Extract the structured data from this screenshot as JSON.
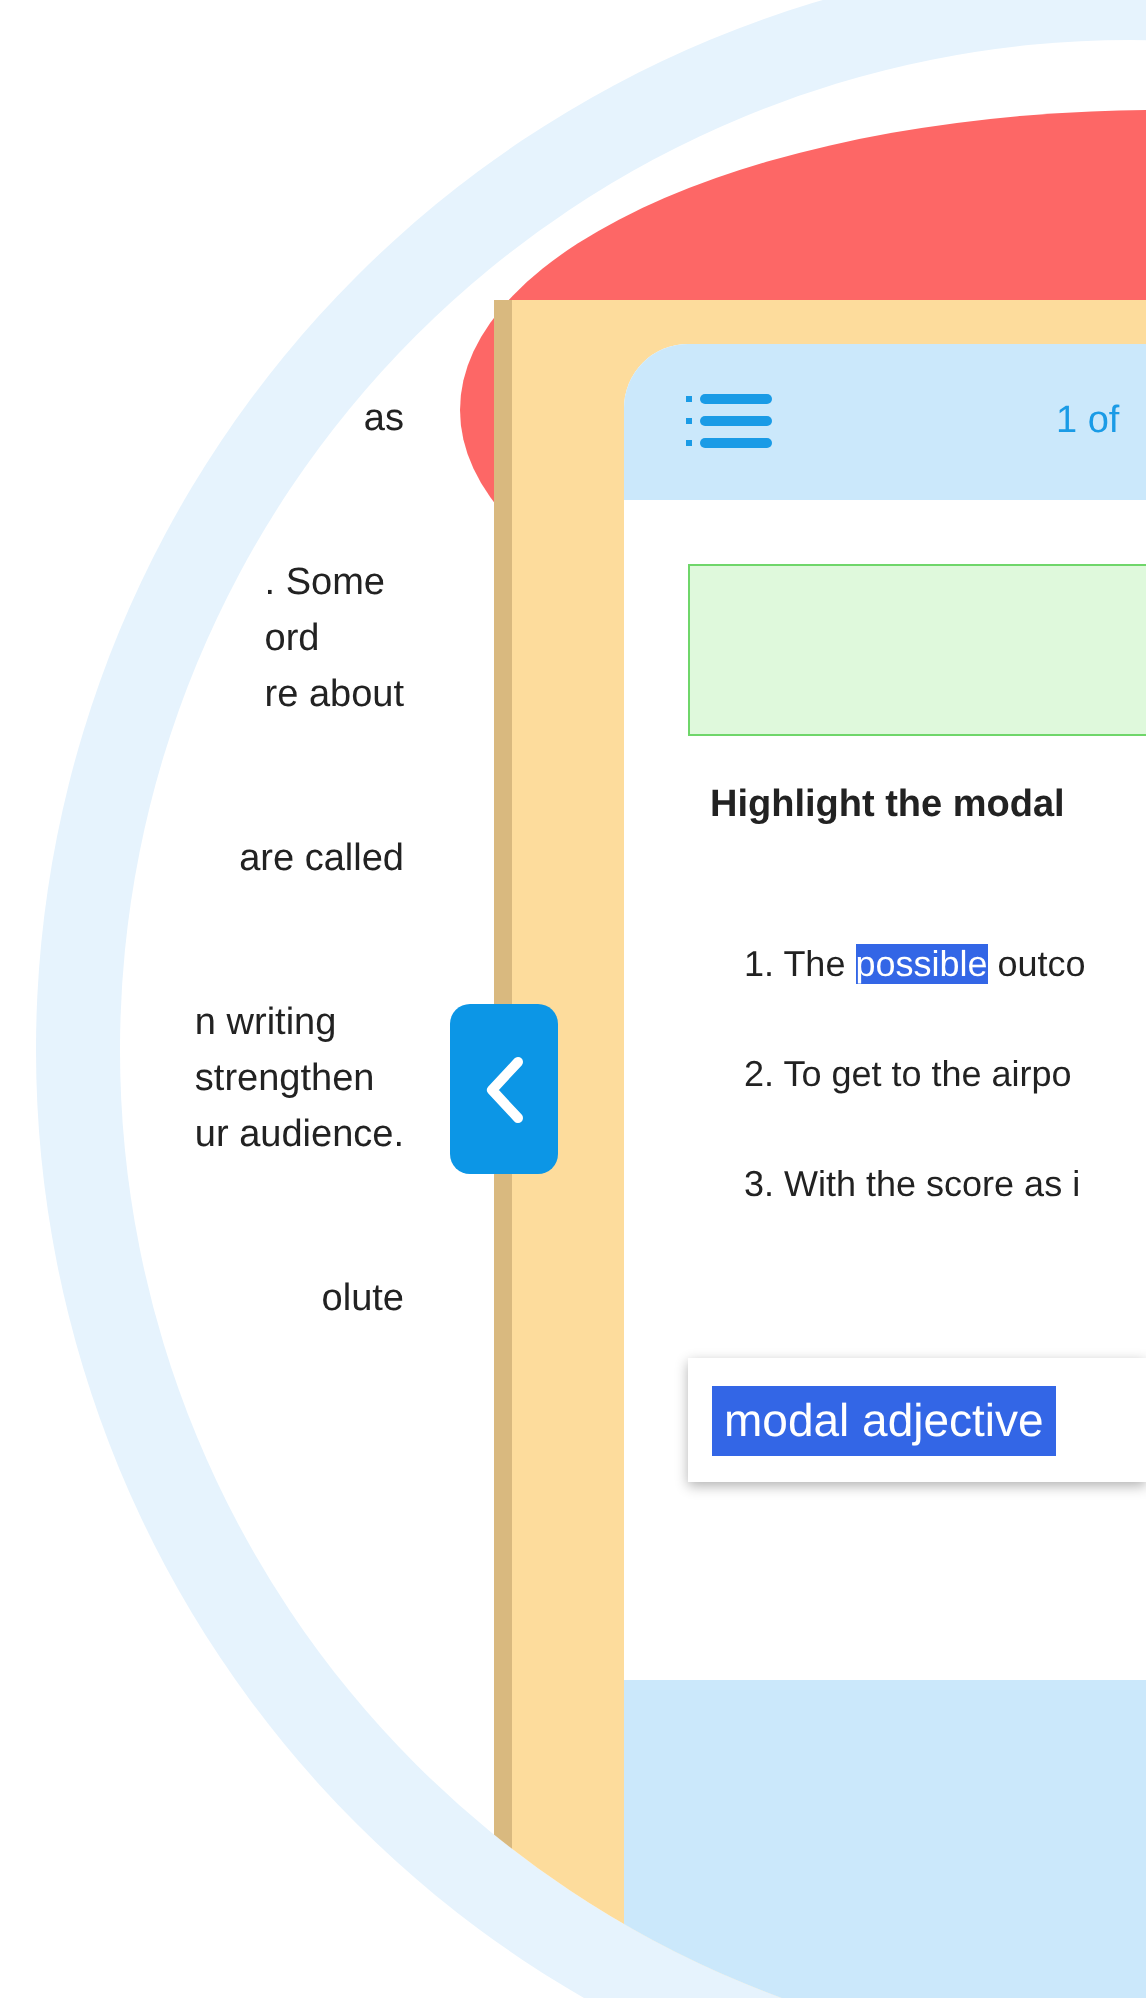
{
  "side_text": [
    [
      "as"
    ],
    [
      ". Some",
      "ord",
      "re about"
    ],
    [
      "are called"
    ],
    [
      "n writing",
      "strengthen",
      "ur audience."
    ],
    [
      "olute"
    ]
  ],
  "header": {
    "counter": "1 of"
  },
  "question": {
    "prompt": "Highlight the modal",
    "items": [
      {
        "number": "1.",
        "before": "The ",
        "highlighted": "possible",
        "after": " outco"
      },
      {
        "number": "2.",
        "before": "To get to the airpo"
      },
      {
        "number": "3.",
        "before": "With the score as i"
      }
    ]
  },
  "answer": {
    "label": "modal adjective"
  }
}
